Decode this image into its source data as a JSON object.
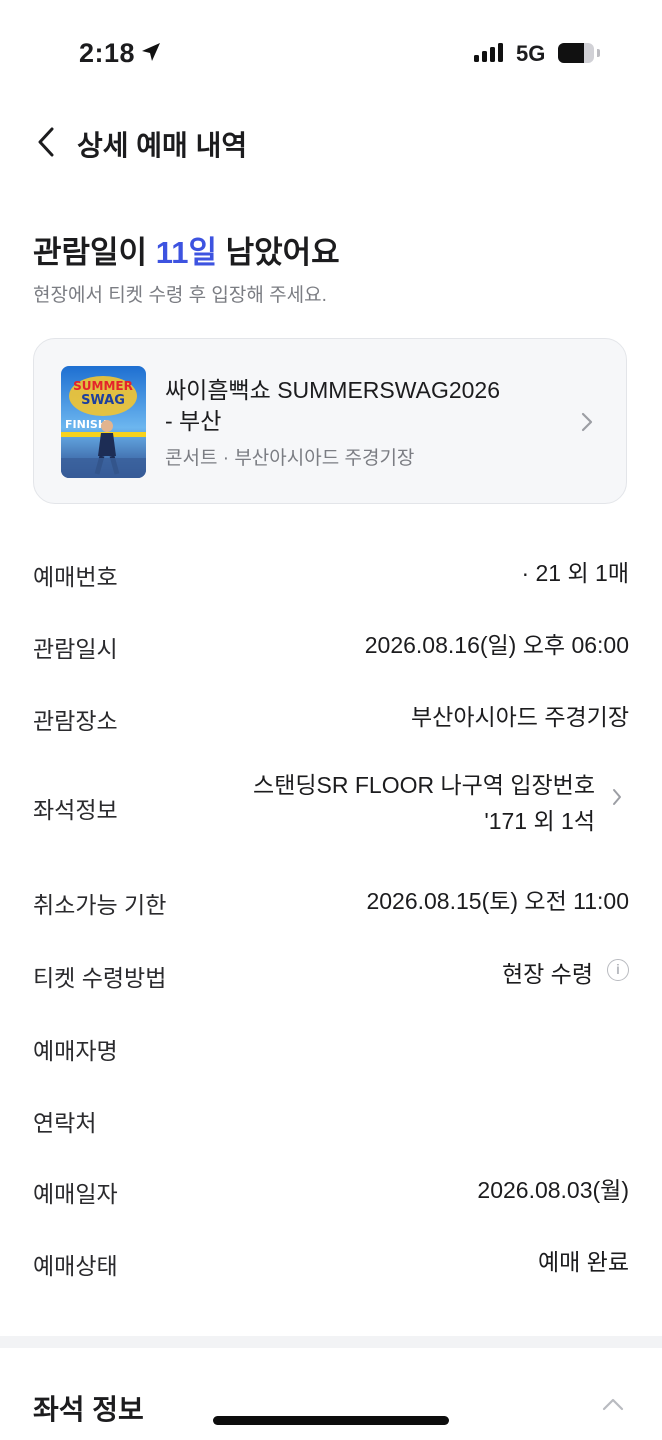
{
  "status_bar": {
    "time": "2:18",
    "network": "5G",
    "battery_level": 0.72
  },
  "header": {
    "title": "상세 예매 내역"
  },
  "dday": {
    "prefix": "관람일이 ",
    "highlight": "11일",
    "suffix": " 남았어요",
    "subtitle": "현장에서 티켓 수령 후 입장해 주세요.",
    "accent_color": "#3d53e0"
  },
  "event": {
    "title_line1": "싸이흠뻑쇼 SUMMERSWAG2026",
    "title_line2": "- 부산",
    "subtitle": "콘서트 · 부산아시아드 주경기장",
    "poster_text_1": "SUMMER",
    "poster_text_2": "SWAG",
    "poster_text_3": "FINISH"
  },
  "details": [
    {
      "label": "예매번호",
      "value": "·                          21 외 1매"
    },
    {
      "label": "관람일시",
      "value": "2026.08.16(일) 오후 06:00"
    },
    {
      "label": "관람장소",
      "value": "부산아시아드 주경기장"
    },
    {
      "label": "좌석정보",
      "value_line1": "스탠딩SR FLOOR 나구역 입장번호",
      "value_line2": "'171 외 1석"
    },
    {
      "label": "취소가능 기한",
      "value": "2026.08.15(토) 오전 11:00"
    },
    {
      "label": "티켓 수령방법",
      "value": "현장 수령",
      "info_icon": "i"
    },
    {
      "label": "예매자명",
      "value": ""
    },
    {
      "label": "연락처",
      "value": ""
    },
    {
      "label": "예매일자",
      "value": "2026.08.03(월)"
    },
    {
      "label": "예매상태",
      "value": "예매 완료"
    }
  ],
  "seat_section": {
    "title": "좌석 정보"
  },
  "icons": [
    "location-arrow-icon",
    "signal-icon",
    "battery-icon",
    "back-chevron-icon",
    "chevron-right-icon",
    "info-icon",
    "chevron-up-icon"
  ]
}
